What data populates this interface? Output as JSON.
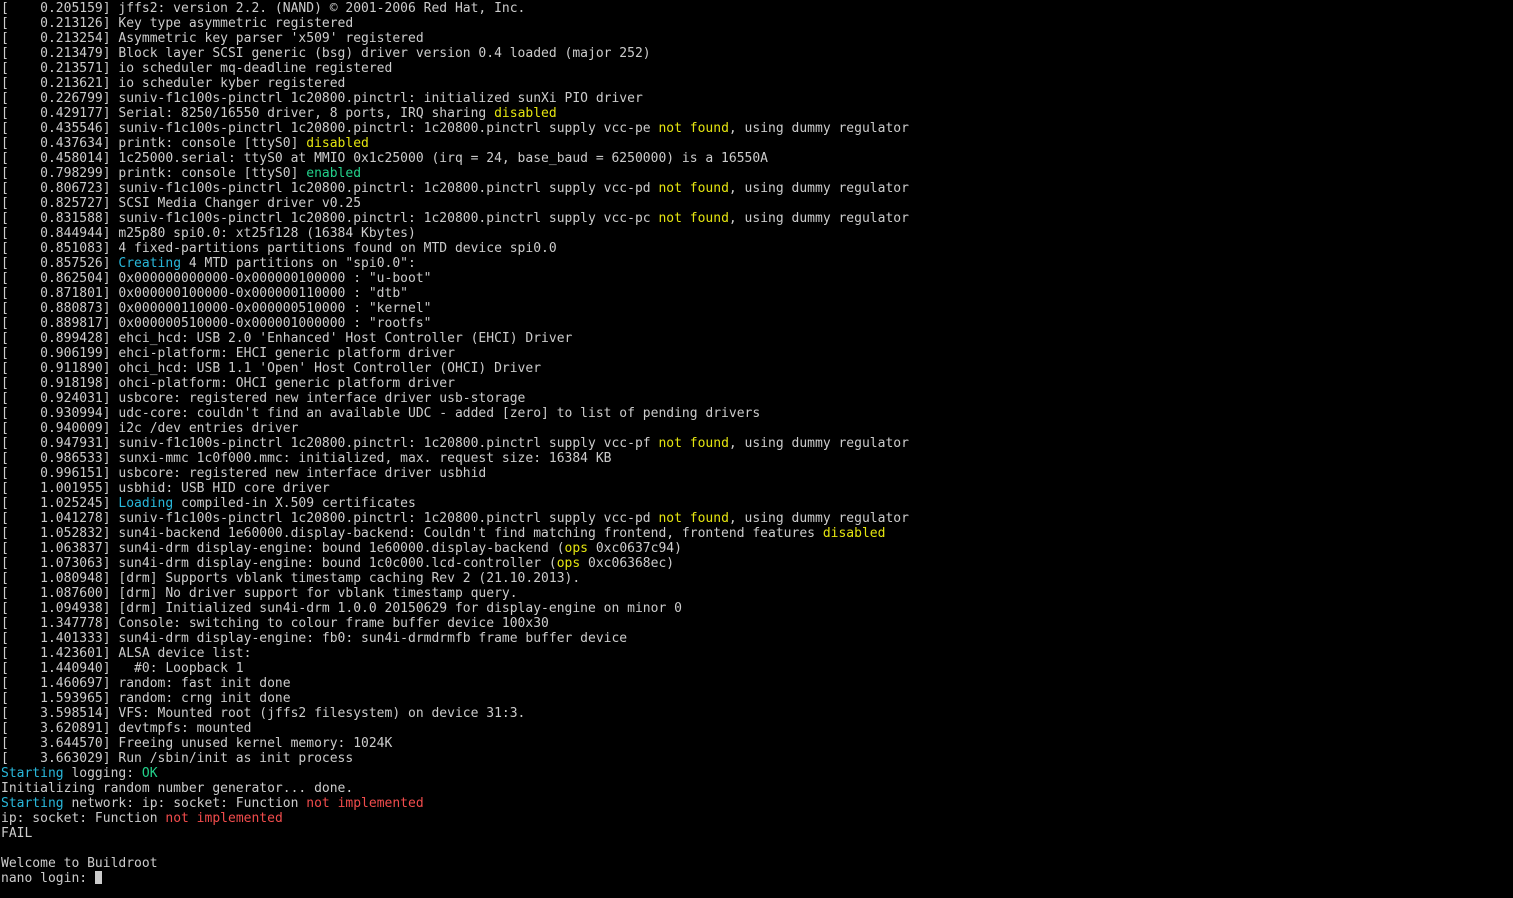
{
  "colors": {
    "background": "#000000",
    "foreground": "#cccccc",
    "yellow": "#e5e510",
    "green": "#23d18b",
    "cyan": "#29b8db",
    "red": "#f14c4c"
  },
  "lines": [
    [
      {
        "t": "[    0.205159] jffs2: version 2.2. (NAND) © 2001-2006 Red Hat, Inc."
      }
    ],
    [
      {
        "t": "[    0.213126] Key type asymmetric registered"
      }
    ],
    [
      {
        "t": "[    0.213254] Asymmetric key parser 'x509' registered"
      }
    ],
    [
      {
        "t": "[    0.213479] Block layer SCSI generic (bsg) driver version 0.4 loaded (major 252)"
      }
    ],
    [
      {
        "t": "[    0.213571] io scheduler mq-deadline registered"
      }
    ],
    [
      {
        "t": "[    0.213621] io scheduler kyber registered"
      }
    ],
    [
      {
        "t": "[    0.226799] suniv-f1c100s-pinctrl 1c20800.pinctrl: initialized sunXi PIO driver"
      }
    ],
    [
      {
        "t": "[    0.429177] Serial: 8250/16550 driver, 8 ports, IRQ sharing "
      },
      {
        "t": "disabled",
        "c": "yellow"
      }
    ],
    [
      {
        "t": "[    0.435546] suniv-f1c100s-pinctrl 1c20800.pinctrl: 1c20800.pinctrl supply vcc-pe "
      },
      {
        "t": "not found",
        "c": "yellow"
      },
      {
        "t": ", using dummy regulator"
      }
    ],
    [
      {
        "t": "[    0.437634] printk: console [ttyS0] "
      },
      {
        "t": "disabled",
        "c": "yellow"
      }
    ],
    [
      {
        "t": "[    0.458014] 1c25000.serial: ttyS0 at MMIO 0x1c25000 (irq = 24, base_baud = 6250000) is a 16550A"
      }
    ],
    [
      {
        "t": "[    0.798299] printk: console [ttyS0] "
      },
      {
        "t": "enabled",
        "c": "green"
      }
    ],
    [
      {
        "t": "[    0.806723] suniv-f1c100s-pinctrl 1c20800.pinctrl: 1c20800.pinctrl supply vcc-pd "
      },
      {
        "t": "not found",
        "c": "yellow"
      },
      {
        "t": ", using dummy regulator"
      }
    ],
    [
      {
        "t": "[    0.825727] SCSI Media Changer driver v0.25"
      }
    ],
    [
      {
        "t": "[    0.831588] suniv-f1c100s-pinctrl 1c20800.pinctrl: 1c20800.pinctrl supply vcc-pc "
      },
      {
        "t": "not found",
        "c": "yellow"
      },
      {
        "t": ", using dummy regulator"
      }
    ],
    [
      {
        "t": "[    0.844944] m25p80 spi0.0: xt25f128 (16384 Kbytes)"
      }
    ],
    [
      {
        "t": "[    0.851083] 4 fixed-partitions partitions found on MTD device spi0.0"
      }
    ],
    [
      {
        "t": "[    0.857526] "
      },
      {
        "t": "Creating",
        "c": "cyan"
      },
      {
        "t": " 4 MTD partitions on \"spi0.0\":"
      }
    ],
    [
      {
        "t": "[    0.862504] 0x000000000000-0x000000100000 : \"u-boot\""
      }
    ],
    [
      {
        "t": "[    0.871801] 0x000000100000-0x000000110000 : \"dtb\""
      }
    ],
    [
      {
        "t": "[    0.880873] 0x000000110000-0x000000510000 : \"kernel\""
      }
    ],
    [
      {
        "t": "[    0.889817] 0x000000510000-0x000001000000 : \"rootfs\""
      }
    ],
    [
      {
        "t": "[    0.899428] ehci_hcd: USB 2.0 'Enhanced' Host Controller (EHCI) Driver"
      }
    ],
    [
      {
        "t": "[    0.906199] ehci-platform: EHCI generic platform driver"
      }
    ],
    [
      {
        "t": "[    0.911890] ohci_hcd: USB 1.1 'Open' Host Controller (OHCI) Driver"
      }
    ],
    [
      {
        "t": "[    0.918198] ohci-platform: OHCI generic platform driver"
      }
    ],
    [
      {
        "t": "[    0.924031] usbcore: registered new interface driver usb-storage"
      }
    ],
    [
      {
        "t": "[    0.930994] udc-core: couldn't find an available UDC - added [zero] to list of pending drivers"
      }
    ],
    [
      {
        "t": "[    0.940009] i2c /dev entries driver"
      }
    ],
    [
      {
        "t": "[    0.947931] suniv-f1c100s-pinctrl 1c20800.pinctrl: 1c20800.pinctrl supply vcc-pf "
      },
      {
        "t": "not found",
        "c": "yellow"
      },
      {
        "t": ", using dummy regulator"
      }
    ],
    [
      {
        "t": "[    0.986533] sunxi-mmc 1c0f000.mmc: initialized, max. request size: 16384 KB"
      }
    ],
    [
      {
        "t": "[    0.996151] usbcore: registered new interface driver usbhid"
      }
    ],
    [
      {
        "t": "[    1.001955] usbhid: USB HID core driver"
      }
    ],
    [
      {
        "t": "[    1.025245] "
      },
      {
        "t": "Loading",
        "c": "cyan"
      },
      {
        "t": " compiled-in X.509 certificates"
      }
    ],
    [
      {
        "t": "[    1.041278] suniv-f1c100s-pinctrl 1c20800.pinctrl: 1c20800.pinctrl supply vcc-pd "
      },
      {
        "t": "not found",
        "c": "yellow"
      },
      {
        "t": ", using dummy regulator"
      }
    ],
    [
      {
        "t": "[    1.052832] sun4i-backend 1e60000.display-backend: Couldn't find matching frontend, frontend features "
      },
      {
        "t": "disabled",
        "c": "yellow"
      }
    ],
    [
      {
        "t": "[    1.063837] sun4i-drm display-engine: bound 1e60000.display-backend ("
      },
      {
        "t": "ops",
        "c": "yellow"
      },
      {
        "t": " 0xc0637c94)"
      }
    ],
    [
      {
        "t": "[    1.073063] sun4i-drm display-engine: bound 1c0c000.lcd-controller ("
      },
      {
        "t": "ops",
        "c": "yellow"
      },
      {
        "t": " 0xc06368ec)"
      }
    ],
    [
      {
        "t": "[    1.080948] [drm] Supports vblank timestamp caching Rev 2 (21.10.2013)."
      }
    ],
    [
      {
        "t": "[    1.087600] [drm] No driver support for vblank timestamp query."
      }
    ],
    [
      {
        "t": "[    1.094938] [drm] Initialized sun4i-drm 1.0.0 20150629 for display-engine on minor 0"
      }
    ],
    [
      {
        "t": "[    1.347778] Console: switching to colour frame buffer device 100x30"
      }
    ],
    [
      {
        "t": "[    1.401333] sun4i-drm display-engine: fb0: sun4i-drmdrmfb frame buffer device"
      }
    ],
    [
      {
        "t": "[    1.423601] ALSA device list:"
      }
    ],
    [
      {
        "t": "[    1.440940]   #0: Loopback 1"
      }
    ],
    [
      {
        "t": "[    1.460697] random: fast init done"
      }
    ],
    [
      {
        "t": "[    1.593965] random: crng init done"
      }
    ],
    [
      {
        "t": "[    3.598514] VFS: Mounted root (jffs2 filesystem) on device 31:3."
      }
    ],
    [
      {
        "t": "[    3.620891] devtmpfs: mounted"
      }
    ],
    [
      {
        "t": "[    3.644570] Freeing unused kernel memory: 1024K"
      }
    ],
    [
      {
        "t": "[    3.663029] Run /sbin/init as init process"
      }
    ],
    [
      {
        "t": "Starting",
        "c": "cyan"
      },
      {
        "t": " logging: "
      },
      {
        "t": "OK",
        "c": "green"
      }
    ],
    [
      {
        "t": "Initializing random number generator... done."
      }
    ],
    [
      {
        "t": "Starting",
        "c": "cyan"
      },
      {
        "t": " network: ip: socket: Function "
      },
      {
        "t": "not implemented",
        "c": "red"
      }
    ],
    [
      {
        "t": "ip: socket: Function "
      },
      {
        "t": "not implemented",
        "c": "red"
      }
    ],
    [
      {
        "t": "FAIL"
      }
    ],
    [],
    [
      {
        "t": "Welcome to Buildroot"
      }
    ]
  ],
  "prompt": {
    "text": "nano login: "
  }
}
